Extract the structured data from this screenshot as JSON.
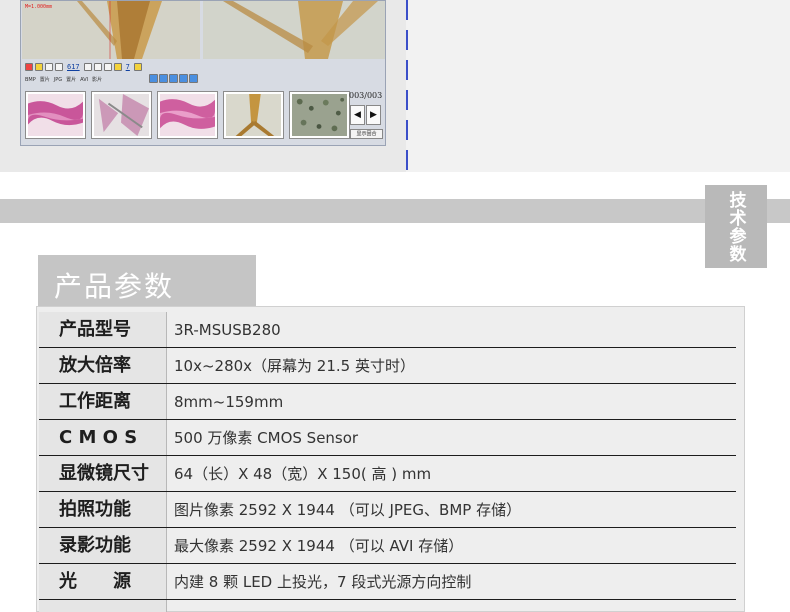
{
  "screenshot": {
    "scale_label": "M=1.000mm",
    "toolbar_number": "617",
    "toolbar_small_number": "7",
    "format_labels": [
      "BMP",
      "置片",
      "JPG",
      "置片",
      "AVI",
      "影片"
    ],
    "counter": "003/003",
    "nav_prev": "◀",
    "nav_next": "▶",
    "side_button": "显示固合",
    "thumbnails": [
      "tissue-pink",
      "tissue-grey",
      "tissue-pink",
      "insect-leg",
      "cells-green"
    ]
  },
  "side_tag": "技术参数",
  "section_title": "产品参数",
  "params": [
    {
      "label": "产品型号",
      "value": "3R-MSUSB280"
    },
    {
      "label": "放大倍率",
      "value": "10x~280x（屏幕为 21.5 英寸时）"
    },
    {
      "label": "工作距离",
      "value": "8mm~159mm"
    },
    {
      "label": "C M O S",
      "value": "500 万像素 CMOS Sensor"
    },
    {
      "label": "显微镜尺寸",
      "value": "64（长）X 48（宽）X 150( 高 ) mm"
    },
    {
      "label": "拍照功能",
      "value": "图片像素 2592 X 1944 （可以 JPEG、BMP 存储）"
    },
    {
      "label": "录影功能",
      "value": "最大像素 2592 X 1944 （可以 AVI 存储）"
    },
    {
      "label": "光　　源",
      "value": "内建 8 颗 LED 上投光，7 段式光源方向控制"
    }
  ],
  "colors": {
    "grey_band": "#c8c8c8",
    "title_bg": "#c5c5c5",
    "accent_line": "#3b4fc9"
  }
}
